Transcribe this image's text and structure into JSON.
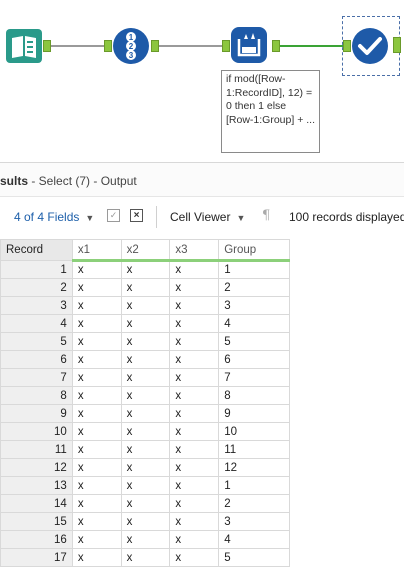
{
  "workflow": {
    "tools": [
      {
        "name": "input-data-tool",
        "icon": "book-icon"
      },
      {
        "name": "record-id-tool",
        "icon": "numbered-list-icon"
      },
      {
        "name": "formula-tool",
        "icon": "beaker-icon"
      },
      {
        "name": "select-tool",
        "icon": "checkmark-icon"
      }
    ],
    "annotation": "if mod([Row-1:RecordID], 12) = 0 then 1 else [Row-1:Group] + ..."
  },
  "results": {
    "title_strong": "sults",
    "title_rest": " - Select (7) - Output"
  },
  "toolbar": {
    "fields_label": "4 of 4 Fields",
    "viewer_label": "Cell Viewer",
    "records_label": "100 records displayed"
  },
  "grid": {
    "columns": [
      "Record",
      "x1",
      "x2",
      "x3",
      "Group"
    ],
    "rows": [
      [
        1,
        "x",
        "x",
        "x",
        "1"
      ],
      [
        2,
        "x",
        "x",
        "x",
        "2"
      ],
      [
        3,
        "x",
        "x",
        "x",
        "3"
      ],
      [
        4,
        "x",
        "x",
        "x",
        "4"
      ],
      [
        5,
        "x",
        "x",
        "x",
        "5"
      ],
      [
        6,
        "x",
        "x",
        "x",
        "6"
      ],
      [
        7,
        "x",
        "x",
        "x",
        "7"
      ],
      [
        8,
        "x",
        "x",
        "x",
        "8"
      ],
      [
        9,
        "x",
        "x",
        "x",
        "9"
      ],
      [
        10,
        "x",
        "x",
        "x",
        "10"
      ],
      [
        11,
        "x",
        "x",
        "x",
        "11"
      ],
      [
        12,
        "x",
        "x",
        "x",
        "12"
      ],
      [
        13,
        "x",
        "x",
        "x",
        "1"
      ],
      [
        14,
        "x",
        "x",
        "x",
        "2"
      ],
      [
        15,
        "x",
        "x",
        "x",
        "3"
      ],
      [
        16,
        "x",
        "x",
        "x",
        "4"
      ],
      [
        17,
        "x",
        "x",
        "x",
        "5"
      ]
    ]
  },
  "colors": {
    "tool_blue": "#1e5aa8",
    "input_teal": "#2a9a8a",
    "anchor_green": "#8cc63f",
    "header_underline": "#8cd07a",
    "link_blue": "#1d5faa"
  }
}
